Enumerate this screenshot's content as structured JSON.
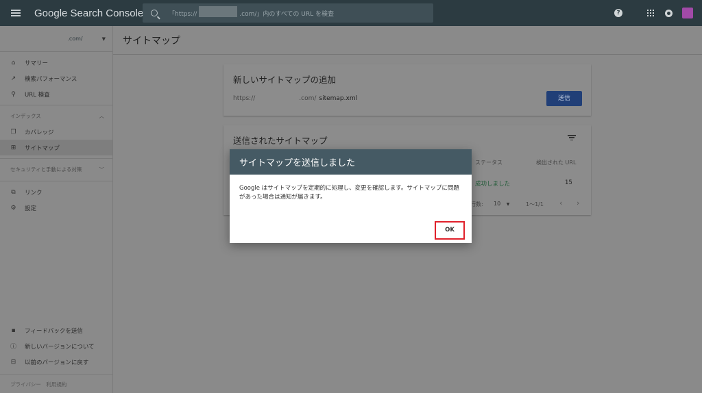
{
  "header": {
    "app_title": "Google Search Console",
    "search_placeholder_prefix": "「https://",
    "search_placeholder_suffix": ".com/」内のすべての URL を検査"
  },
  "sidebar": {
    "property": ".com/",
    "items": [
      {
        "label": "サマリー",
        "icon": "home-icon"
      },
      {
        "label": "検索パフォーマンス",
        "icon": "trending-up-icon"
      },
      {
        "label": "URL 検査",
        "icon": "search-icon"
      }
    ],
    "index_section": "インデックス",
    "index_items": [
      {
        "label": "カバレッジ",
        "icon": "copy-icon"
      },
      {
        "label": "サイトマップ",
        "icon": "sitemap-icon"
      }
    ],
    "security_section": "セキュリティと手動による対策",
    "other_items": [
      {
        "label": "リンク",
        "icon": "link-icon"
      },
      {
        "label": "設定",
        "icon": "gear-icon"
      }
    ],
    "footer_items": [
      {
        "label": "フィードバックを送信",
        "icon": "feedback-icon"
      },
      {
        "label": "新しいバージョンについて",
        "icon": "info-icon"
      },
      {
        "label": "以前のバージョンに戻す",
        "icon": "exit-icon"
      }
    ],
    "legal": "プライバシー　利用規約"
  },
  "page": {
    "title": "サイトマップ"
  },
  "add_card": {
    "title": "新しいサイトマップの追加",
    "url_prefix": "https://",
    "url_domain": ".com/",
    "url_value": "sitemap.xml",
    "submit_label": "送信"
  },
  "submitted_card": {
    "title": "送信されたサイトマップ",
    "col_status": "ステータス",
    "col_urls": "検出された URL",
    "row_status": "成功しました",
    "row_count": "15",
    "rows_label": "行数:",
    "rows_value": "10",
    "range": "1〜1/1"
  },
  "dialog": {
    "title": "サイトマップを送信しました",
    "body": "Google はサイトマップを定期的に処理し、変更を確認します。サイトマップに問題があった場合は通知が届きます。",
    "ok_label": "OK"
  },
  "colors": {
    "topbar": "#2c3b41",
    "dialog_header": "#455a64",
    "primary_button": "#213f77",
    "highlight_border": "#e0202a",
    "success_text": "#1e5a35"
  }
}
